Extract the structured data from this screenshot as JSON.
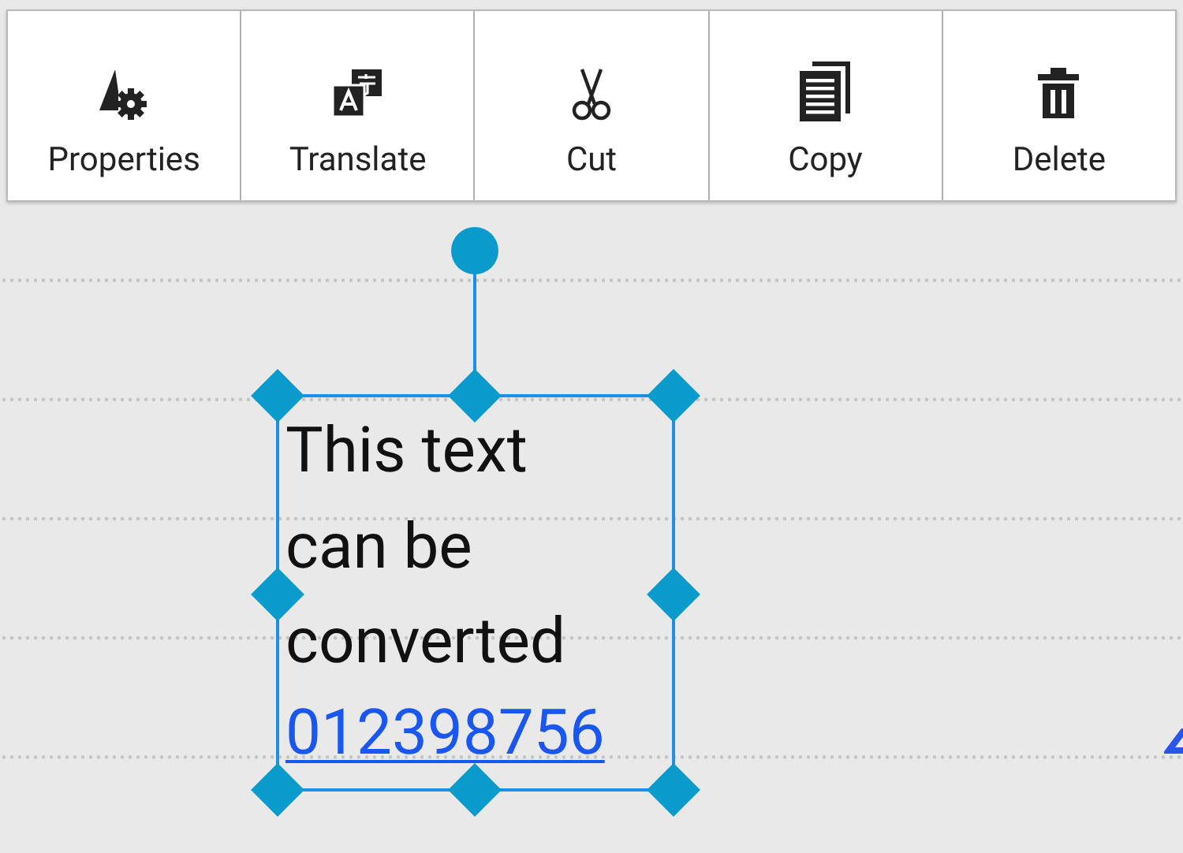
{
  "toolbar": [
    {
      "kind": "properties",
      "label": "Properties"
    },
    {
      "kind": "translate",
      "label": "Translate"
    },
    {
      "kind": "cut",
      "label": "Cut"
    },
    {
      "kind": "copy",
      "label": "Copy"
    },
    {
      "kind": "delete",
      "label": "Delete"
    }
  ],
  "text_box": {
    "text": "This text can be converted",
    "link": "012398756",
    "selected": true
  }
}
